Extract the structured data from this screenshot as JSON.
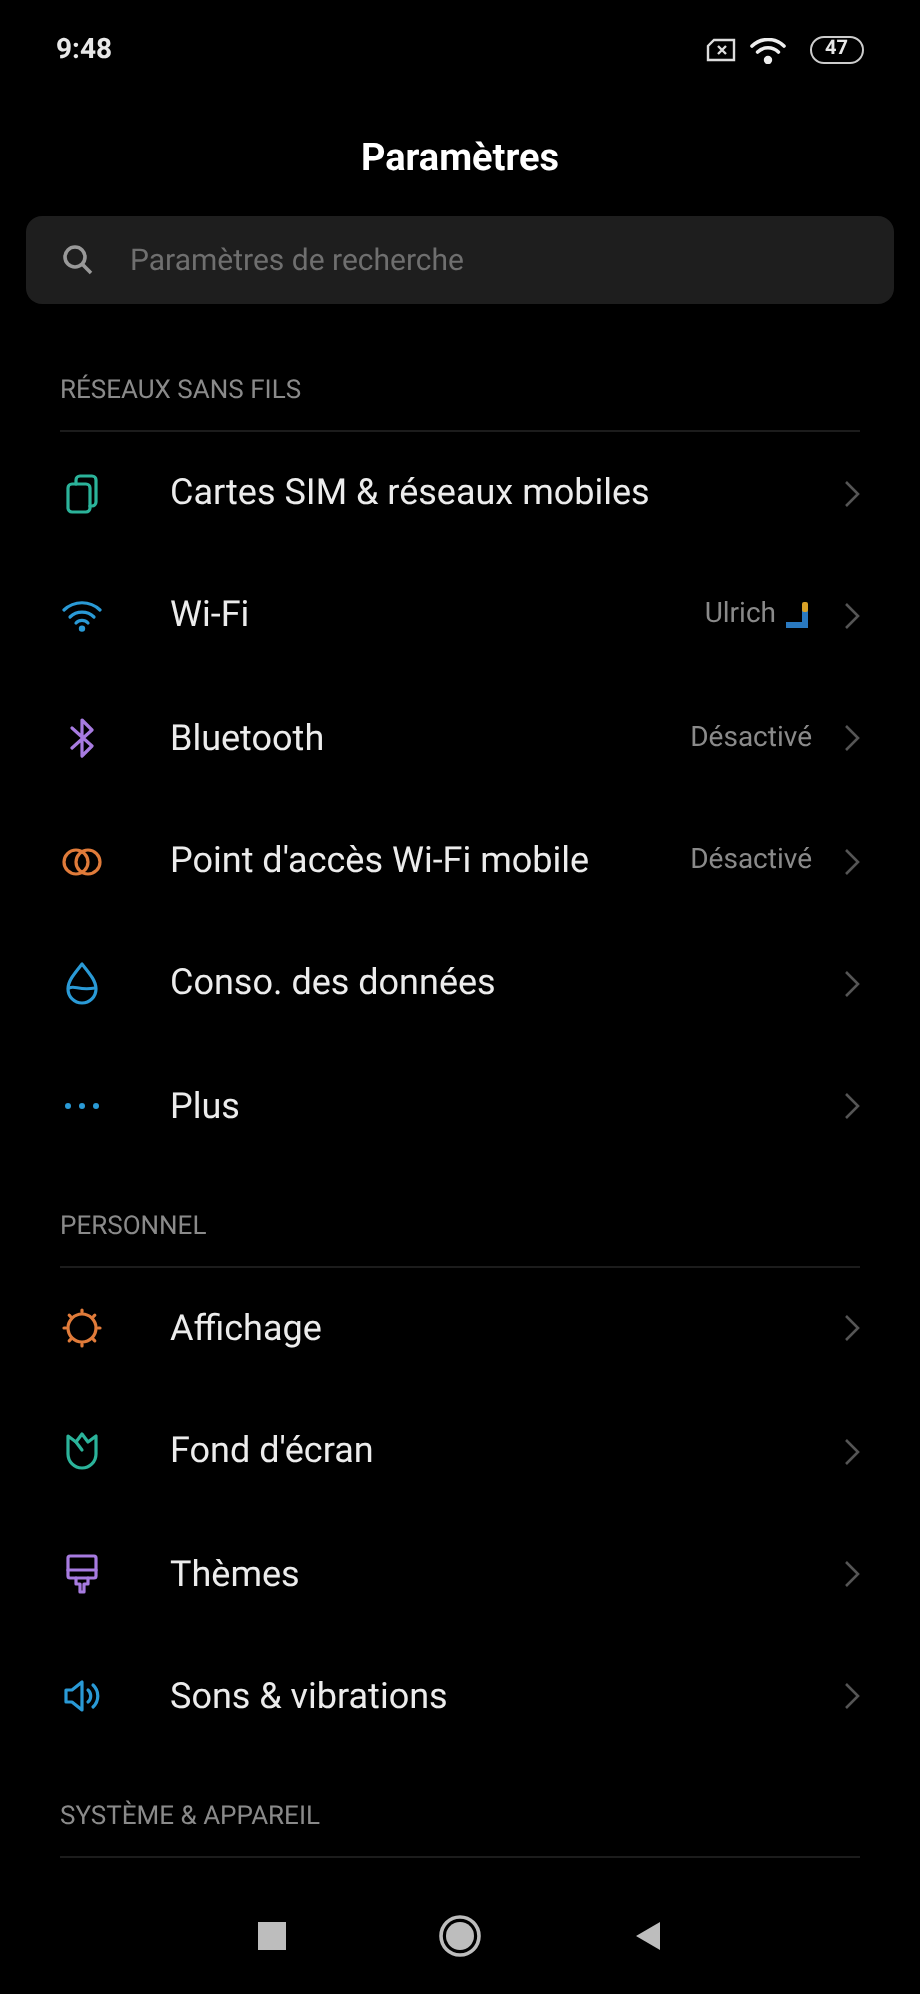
{
  "status_bar": {
    "time": "9:48",
    "battery": "47"
  },
  "title": "Paramètres",
  "search": {
    "placeholder": "Paramètres de recherche"
  },
  "sections": [
    {
      "header": "RÉSEAUX SANS FILS",
      "items": [
        {
          "label": "Cartes SIM & réseaux mobiles"
        },
        {
          "label": "Wi-Fi",
          "value": "Ulrich"
        },
        {
          "label": "Bluetooth",
          "value": "Désactivé"
        },
        {
          "label": "Point d'accès Wi-Fi mobile",
          "value": "Désactivé"
        },
        {
          "label": "Conso. des données"
        },
        {
          "label": "Plus"
        }
      ]
    },
    {
      "header": "PERSONNEL",
      "items": [
        {
          "label": "Affichage"
        },
        {
          "label": "Fond d'écran"
        },
        {
          "label": "Thèmes"
        },
        {
          "label": "Sons & vibrations"
        }
      ]
    },
    {
      "header": "SYSTÈME & APPAREIL"
    }
  ]
}
